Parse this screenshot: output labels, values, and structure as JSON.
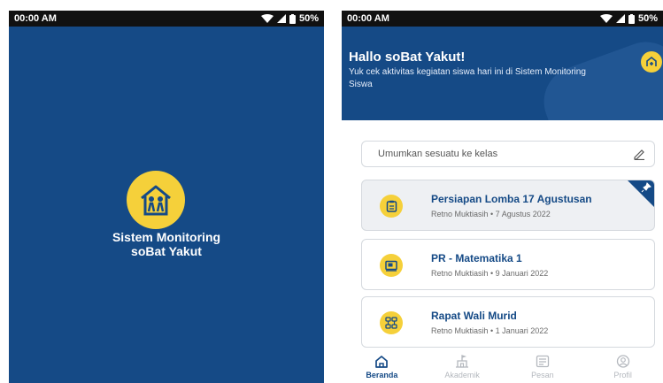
{
  "left_phone": {
    "status_time": "00:00 AM",
    "status_battery": "50%",
    "app_name_line1": "Sistem Monitoring",
    "app_name_line2": "soBat Yakut"
  },
  "right_phone": {
    "status_time": "00:00 AM",
    "status_battery": "50%",
    "greeting": "Hallo soBat Yakut!",
    "subtitle": "Yuk cek aktivitas kegiatan siswa hari ini di Sistem Monitoring Siswa",
    "announce_placeholder": "Umumkan sesuatu ke kelas",
    "cards": [
      {
        "title": "Persiapan Lomba 17 Agustusan",
        "meta": "Retno Muktiasih  •  7 Agustus 2022",
        "pinned": true,
        "icon": "clipboard-icon"
      },
      {
        "title": "PR - Matematika 1",
        "meta": "Retno Muktiasih  •  9 Januari 2022",
        "pinned": false,
        "icon": "book-icon"
      },
      {
        "title": "Rapat Wali Murid",
        "meta": "Retno Muktiasih  •  1 Januari 2022",
        "pinned": false,
        "icon": "meeting-icon"
      }
    ],
    "nav": [
      {
        "label": "Beranda",
        "icon": "home-icon",
        "active": true
      },
      {
        "label": "Akademik",
        "icon": "school-icon",
        "active": false
      },
      {
        "label": "Pesan",
        "icon": "message-icon",
        "active": false
      },
      {
        "label": "Profil",
        "icon": "profile-icon",
        "active": false
      }
    ]
  },
  "colors": {
    "primary": "#154a86",
    "accent": "#f5d03a"
  }
}
